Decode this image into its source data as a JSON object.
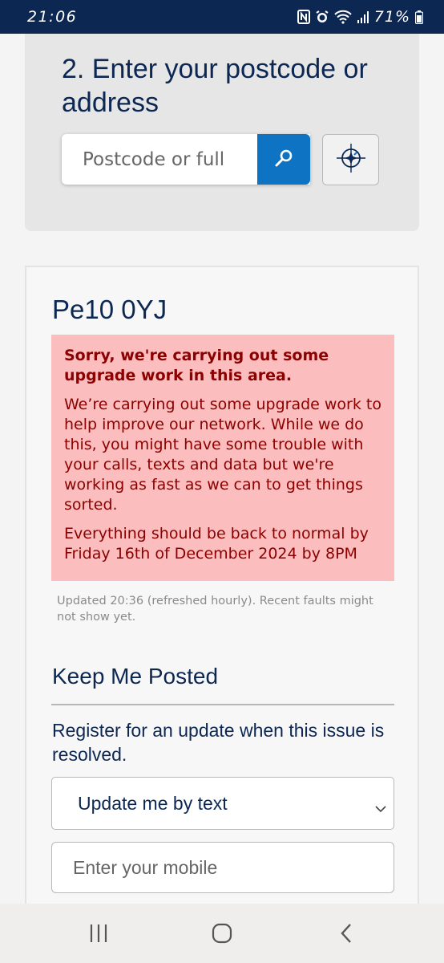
{
  "status_bar": {
    "time": "21:06",
    "battery_percent": "71%",
    "icons": [
      "nfc-icon",
      "alarm-icon",
      "wifi-icon",
      "signal-icon",
      "battery-icon"
    ]
  },
  "search": {
    "heading": "2. Enter your postcode or address",
    "placeholder": "Postcode or full",
    "search_icon": "search-icon",
    "locate_icon": "compass-locate-icon"
  },
  "result": {
    "postcode": "Pe10 0YJ",
    "alert": {
      "title": "Sorry, we're carrying out some upgrade work in this area.",
      "body": "We’re carrying out some upgrade work to help improve our network. While we do this, you might have some trouble with your calls, texts and data but we're working as fast as we can to get things sorted.",
      "eta": "Everything should be back to normal by Friday 16th of December 2024 by 8PM"
    },
    "updated_note": "Updated 20:36 (refreshed hourly). Recent faults might not show yet."
  },
  "keep_posted": {
    "title": "Keep Me Posted",
    "register_text": "Register for an update when this issue is resolved.",
    "method_selected": "Update me by text",
    "mobile_placeholder": "Enter your mobile"
  },
  "nav_bar": {
    "icons": [
      "recent-apps-icon",
      "home-icon",
      "back-icon"
    ]
  },
  "colors": {
    "navy": "#0c2752",
    "accent_blue": "#0d73c2",
    "alert_bg": "#fbbdbd",
    "alert_text": "#8b0000"
  }
}
